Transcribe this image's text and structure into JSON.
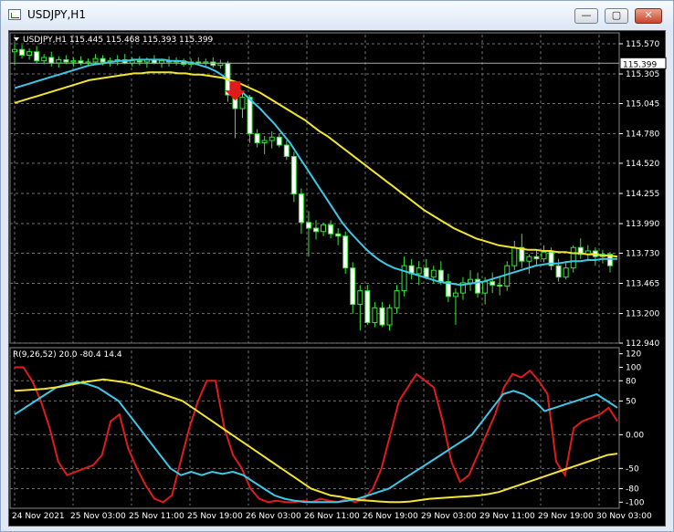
{
  "window": {
    "title": "USDJPY,H1",
    "buttons": {
      "minimize": "—",
      "maximize": "▢",
      "close": "✕"
    }
  },
  "chart_data": [
    {
      "type": "candlestick",
      "symbol": "USDJPY",
      "timeframe": "H1",
      "header": "USDJPY,H1  115.445 115.468 115.393 115.399",
      "price_label": "115.399",
      "yticks": [
        "115.570",
        "115.305",
        "115.045",
        "114.780",
        "114.520",
        "114.255",
        "113.990",
        "113.730",
        "113.465",
        "113.200",
        "112.940"
      ],
      "ylim": [
        112.94,
        115.65
      ],
      "xticks": [
        "24 Nov 2021",
        "25 Nov 03:00",
        "25 Nov 11:00",
        "25 Nov 19:00",
        "26 Nov 03:00",
        "26 Nov 11:00",
        "26 Nov 19:00",
        "29 Nov 03:00",
        "29 Nov 11:00",
        "29 Nov 19:00",
        "30 Nov 03:00"
      ],
      "ohlc": [
        [
          115.5,
          115.58,
          115.38,
          115.52
        ],
        [
          115.52,
          115.56,
          115.44,
          115.47
        ],
        [
          115.47,
          115.53,
          115.43,
          115.5
        ],
        [
          115.5,
          115.55,
          115.4,
          115.42
        ],
        [
          115.42,
          115.48,
          115.39,
          115.45
        ],
        [
          115.45,
          115.5,
          115.37,
          115.4
        ],
        [
          115.4,
          115.46,
          115.36,
          115.43
        ],
        [
          115.43,
          115.47,
          115.39,
          115.41
        ],
        [
          115.41,
          115.45,
          115.37,
          115.42
        ],
        [
          115.42,
          115.46,
          115.38,
          115.4
        ],
        [
          115.4,
          115.44,
          115.37,
          115.41
        ],
        [
          115.41,
          115.48,
          115.39,
          115.44
        ],
        [
          115.44,
          115.47,
          115.38,
          115.41
        ],
        [
          115.41,
          115.45,
          115.37,
          115.42
        ],
        [
          115.42,
          115.47,
          115.38,
          115.43
        ],
        [
          115.43,
          115.48,
          115.39,
          115.4
        ],
        [
          115.4,
          115.45,
          115.37,
          115.42
        ],
        [
          115.42,
          115.46,
          115.38,
          115.41
        ],
        [
          115.41,
          115.45,
          115.36,
          115.43
        ],
        [
          115.43,
          115.47,
          115.39,
          115.4
        ],
        [
          115.4,
          115.44,
          115.36,
          115.42
        ],
        [
          115.42,
          115.46,
          115.37,
          115.41
        ],
        [
          115.41,
          115.45,
          115.38,
          115.42
        ],
        [
          115.42,
          115.44,
          115.37,
          115.39
        ],
        [
          115.39,
          115.44,
          115.36,
          115.41
        ],
        [
          115.41,
          115.45,
          115.38,
          115.4
        ],
        [
          115.4,
          115.44,
          115.37,
          115.41
        ],
        [
          115.41,
          115.45,
          115.36,
          115.38
        ],
        [
          115.38,
          115.43,
          115.35,
          115.4
        ],
        [
          115.4,
          115.42,
          115.06,
          115.12
        ],
        [
          115.12,
          115.18,
          114.74,
          115.0
        ],
        [
          115.0,
          115.15,
          114.92,
          115.1
        ],
        [
          115.1,
          115.12,
          114.7,
          114.78
        ],
        [
          114.78,
          114.82,
          114.66,
          114.7
        ],
        [
          114.7,
          114.76,
          114.6,
          114.72
        ],
        [
          114.72,
          114.8,
          114.65,
          114.75
        ],
        [
          114.75,
          114.78,
          114.66,
          114.68
        ],
        [
          114.68,
          114.72,
          114.55,
          114.58
        ],
        [
          114.58,
          114.62,
          114.18,
          114.25
        ],
        [
          114.25,
          114.3,
          113.9,
          114.0
        ],
        [
          114.0,
          114.1,
          113.7,
          113.95
        ],
        [
          113.95,
          114.02,
          113.85,
          113.92
        ],
        [
          113.92,
          114.0,
          113.88,
          113.98
        ],
        [
          113.98,
          114.02,
          113.86,
          113.9
        ],
        [
          113.9,
          113.95,
          113.8,
          113.88
        ],
        [
          113.88,
          113.92,
          113.55,
          113.6
        ],
        [
          113.6,
          113.65,
          113.2,
          113.28
        ],
        [
          113.28,
          113.45,
          113.05,
          113.4
        ],
        [
          113.4,
          113.45,
          113.1,
          113.12
        ],
        [
          113.12,
          113.3,
          113.08,
          113.25
        ],
        [
          113.25,
          113.3,
          113.08,
          113.1
        ],
        [
          113.1,
          113.28,
          113.05,
          113.25
        ],
        [
          113.25,
          113.45,
          113.2,
          113.4
        ],
        [
          113.4,
          113.7,
          113.35,
          113.62
        ],
        [
          113.62,
          113.68,
          113.5,
          113.55
        ],
        [
          113.55,
          113.66,
          113.45,
          113.6
        ],
        [
          113.6,
          113.68,
          113.5,
          113.52
        ],
        [
          113.52,
          113.62,
          113.46,
          113.58
        ],
        [
          113.58,
          113.66,
          113.45,
          113.48
        ],
        [
          113.48,
          113.55,
          113.3,
          113.35
        ],
        [
          113.35,
          113.42,
          113.1,
          113.38
        ],
        [
          113.38,
          113.52,
          113.32,
          113.47
        ],
        [
          113.47,
          113.58,
          113.4,
          113.5
        ],
        [
          113.5,
          113.56,
          113.34,
          113.38
        ],
        [
          113.38,
          113.52,
          113.28,
          113.48
        ],
        [
          113.48,
          113.56,
          113.38,
          113.45
        ],
        [
          113.45,
          113.52,
          113.36,
          113.44
        ],
        [
          113.44,
          113.66,
          113.4,
          113.62
        ],
        [
          113.62,
          113.84,
          113.58,
          113.78
        ],
        [
          113.78,
          113.9,
          113.6,
          113.66
        ],
        [
          113.66,
          113.72,
          113.55,
          113.7
        ],
        [
          113.7,
          113.76,
          113.62,
          113.68
        ],
        [
          113.68,
          113.8,
          113.65,
          113.74
        ],
        [
          113.74,
          113.78,
          113.58,
          113.62
        ],
        [
          113.62,
          113.68,
          113.48,
          113.52
        ],
        [
          113.52,
          113.66,
          113.5,
          113.6
        ],
        [
          113.6,
          113.8,
          113.56,
          113.78
        ],
        [
          113.78,
          113.86,
          113.68,
          113.72
        ],
        [
          113.72,
          113.8,
          113.66,
          113.75
        ],
        [
          113.75,
          113.78,
          113.62,
          113.7
        ],
        [
          113.7,
          113.76,
          113.64,
          113.72
        ],
        [
          113.72,
          113.74,
          113.56,
          113.62
        ]
      ],
      "series": [
        {
          "color": "#3ec8e8",
          "values": [
            115.18,
            115.2,
            115.22,
            115.24,
            115.26,
            115.28,
            115.3,
            115.32,
            115.34,
            115.36,
            115.38,
            115.39,
            115.4,
            115.41,
            115.42,
            115.42,
            115.43,
            115.43,
            115.43,
            115.43,
            115.43,
            115.42,
            115.42,
            115.41,
            115.4,
            115.38,
            115.36,
            115.33,
            115.29,
            115.24,
            115.18,
            115.12,
            115.06,
            115.0,
            114.93,
            114.86,
            114.78,
            114.7,
            114.6,
            114.5,
            114.4,
            114.3,
            114.2,
            114.1,
            114.0,
            113.92,
            113.85,
            113.78,
            113.72,
            113.67,
            113.63,
            113.6,
            113.58,
            113.56,
            113.54,
            113.52,
            113.5,
            113.48,
            113.47,
            113.46,
            113.45,
            113.46,
            113.47,
            113.48,
            113.5,
            113.52,
            113.54,
            113.56,
            113.58,
            113.6,
            113.62,
            113.63,
            113.64,
            113.64,
            113.65,
            113.66,
            113.66,
            113.67,
            113.67,
            113.68,
            113.68,
            113.68
          ]
        },
        {
          "color": "#f2e430",
          "values": [
            115.05,
            115.07,
            115.09,
            115.11,
            115.13,
            115.15,
            115.17,
            115.19,
            115.21,
            115.23,
            115.25,
            115.26,
            115.27,
            115.28,
            115.29,
            115.3,
            115.31,
            115.31,
            115.32,
            115.32,
            115.32,
            115.32,
            115.31,
            115.31,
            115.3,
            115.3,
            115.29,
            115.28,
            115.27,
            115.25,
            115.23,
            115.2,
            115.17,
            115.14,
            115.1,
            115.06,
            115.02,
            114.98,
            114.94,
            114.9,
            114.85,
            114.8,
            114.76,
            114.71,
            114.66,
            114.61,
            114.56,
            114.51,
            114.46,
            114.41,
            114.36,
            114.31,
            114.26,
            114.21,
            114.16,
            114.11,
            114.07,
            114.03,
            113.99,
            113.95,
            113.92,
            113.89,
            113.86,
            113.84,
            113.82,
            113.8,
            113.79,
            113.78,
            113.77,
            113.76,
            113.76,
            113.75,
            113.75,
            113.74,
            113.74,
            113.73,
            113.73,
            113.72,
            113.72,
            113.71,
            113.71,
            113.7
          ]
        }
      ]
    },
    {
      "type": "line",
      "header": "R(9,26,52) 20.0 -80.4 14.4",
      "yticks": [
        "120",
        "100",
        "80",
        "50",
        "0.00",
        "-50",
        "-80",
        "-100"
      ],
      "ylim": [
        -105,
        125
      ],
      "series": [
        {
          "color": "#e01b1b",
          "values": [
            100,
            100,
            80,
            50,
            10,
            -40,
            -60,
            -55,
            -50,
            -45,
            -30,
            20,
            30,
            -20,
            -50,
            -75,
            -95,
            -100,
            -90,
            -40,
            10,
            50,
            80,
            80,
            10,
            -30,
            -50,
            -80,
            -95,
            -100,
            -98,
            -100,
            -100,
            -98,
            -100,
            -95,
            -98,
            -100,
            -95,
            -100,
            -95,
            -80,
            -50,
            0,
            50,
            70,
            90,
            80,
            70,
            20,
            -40,
            -70,
            -60,
            -30,
            0,
            30,
            70,
            90,
            85,
            95,
            80,
            60,
            -40,
            -60,
            10,
            20,
            25,
            30,
            40,
            20
          ]
        },
        {
          "color": "#3ec8e8",
          "values": [
            30,
            40,
            50,
            60,
            70,
            75,
            78,
            75,
            70,
            60,
            50,
            30,
            10,
            -10,
            -30,
            -50,
            -60,
            -55,
            -60,
            -55,
            -58,
            -55,
            -60,
            -70,
            -80,
            -90,
            -95,
            -98,
            -100,
            -100,
            -100,
            -100,
            -98,
            -95,
            -90,
            -85,
            -80,
            -70,
            -60,
            -50,
            -40,
            -30,
            -20,
            -10,
            0,
            20,
            40,
            60,
            65,
            60,
            50,
            35,
            40,
            45,
            50,
            55,
            60,
            50,
            40
          ]
        },
        {
          "color": "#f2e430",
          "values": [
            65,
            66,
            67,
            68,
            70,
            72,
            75,
            78,
            80,
            82,
            80,
            78,
            75,
            70,
            65,
            60,
            55,
            50,
            40,
            30,
            20,
            10,
            0,
            -10,
            -20,
            -30,
            -40,
            -50,
            -60,
            -70,
            -80,
            -85,
            -90,
            -92,
            -95,
            -97,
            -98,
            -99,
            -100,
            -100,
            -99,
            -97,
            -95,
            -94,
            -93,
            -92,
            -91,
            -90,
            -88,
            -85,
            -80,
            -75,
            -70,
            -65,
            -60,
            -55,
            -50,
            -45,
            -40,
            -35,
            -30,
            -28
          ]
        }
      ]
    }
  ]
}
